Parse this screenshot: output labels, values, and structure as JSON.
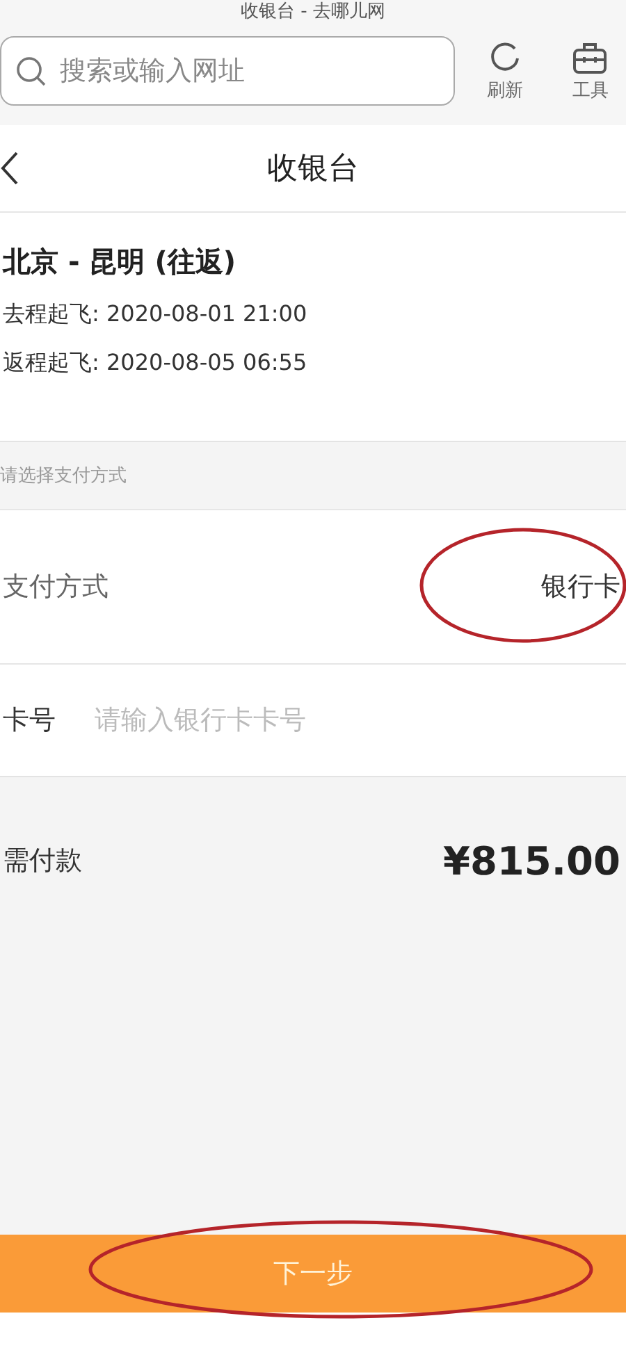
{
  "browser": {
    "page_title": "收银台 - 去哪儿网",
    "search": {
      "placeholder": "搜索或输入网址"
    },
    "actions": [
      {
        "kind": "refresh",
        "label": "刷新"
      },
      {
        "kind": "toolbox",
        "label": "工具"
      }
    ]
  },
  "header": {
    "title": "收银台"
  },
  "trip": {
    "route": "北京 - 昆明 (往返)",
    "legs": [
      "去程起飞: 2020-08-01 21:00",
      "返程起飞: 2020-08-05 06:55"
    ]
  },
  "section_label": "请选择支付方式",
  "payment": {
    "label": "支付方式",
    "value": "银行卡",
    "circled": true
  },
  "card_number": {
    "label": "卡号",
    "placeholder": "请输入银行卡卡号"
  },
  "amount": {
    "label": "需付款",
    "value": "¥815.00"
  },
  "next_button": {
    "label": "下一步",
    "circled": true
  }
}
